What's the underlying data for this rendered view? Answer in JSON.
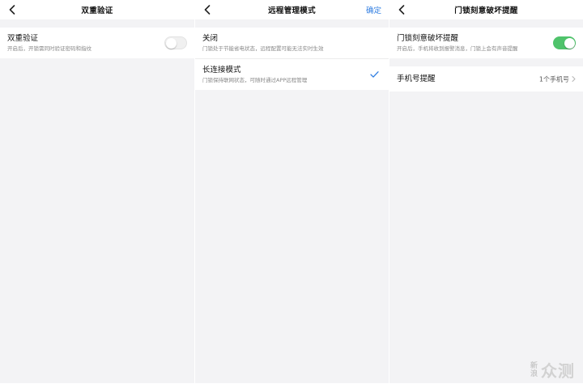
{
  "panel1": {
    "title": "双重验证",
    "row": {
      "title": "双重验证",
      "subtitle": "开启后，开锁需同时验证密码和指纹",
      "toggle_state": "off"
    }
  },
  "panel2": {
    "title": "远程管理模式",
    "action": "确定",
    "options": [
      {
        "title": "关闭",
        "subtitle": "门锁处于节能省电状态，远程配置可能无法实时生效",
        "selected": false
      },
      {
        "title": "长连接模式",
        "subtitle": "门锁保持联网状态，可随时通过APP远程管理",
        "selected": true
      }
    ]
  },
  "panel3": {
    "title": "门锁刻意破坏提醒",
    "row": {
      "title": "门锁刻意破坏提醒",
      "subtitle": "开启后，手机将收到报警消息，门锁上会有声音提醒",
      "toggle_state": "on"
    },
    "phone_row": {
      "title": "手机号提醒",
      "value": "1个手机号"
    }
  },
  "watermark": {
    "vertical_line1": "新",
    "vertical_line2": "浪",
    "main": "众测"
  },
  "colors": {
    "accent": "#2f7de1",
    "toggle_on": "#4fc36b",
    "background": "#f3f3f5"
  },
  "icons": {
    "back": "chevron-left-icon",
    "selected": "checkmark-icon",
    "disclosure": "chevron-right-icon"
  }
}
